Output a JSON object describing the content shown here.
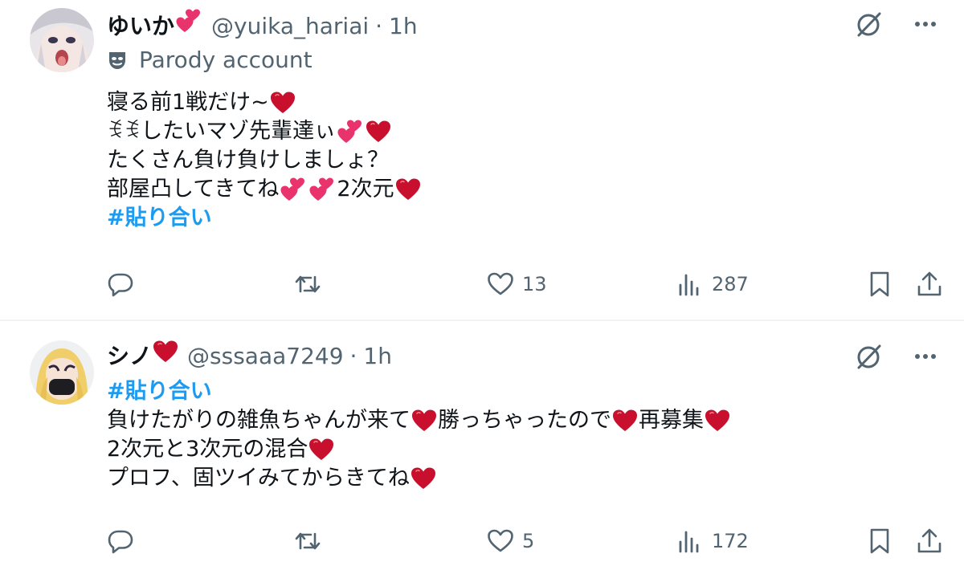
{
  "tweets": [
    {
      "display_name": "ゆいか",
      "handle": "@yuika_hariai",
      "separator": "·",
      "time": "1h",
      "parody_label": "Parody account",
      "lines": [
        "寝る前1戦だけ~",
        "ꉂꉂしたいマゾ先輩達ぃ",
        "たくさん負け負けしましょ？",
        "部屋凸してきてね",
        "2次元"
      ],
      "hashtag": "#貼り合い",
      "likes": "13",
      "views": "287"
    },
    {
      "display_name": "シノ",
      "handle": "@sssaaa7249",
      "separator": "·",
      "time": "1h",
      "hashtag": "#貼り合い",
      "lines": [
        "負けたがりの雑魚ちゃんが来て",
        "勝っちゃったので",
        "再募集",
        "2次元と3次元の混合",
        "プロフ、固ツイみてからきてね"
      ],
      "likes": "5",
      "views": "172"
    }
  ],
  "icons": {
    "verified_like": "parody-mask-icon",
    "grok": "grok-icon",
    "more": "more-icon",
    "reply": "reply-icon",
    "repost": "repost-icon",
    "like": "like-icon",
    "views": "views-icon",
    "bookmark": "bookmark-icon",
    "share": "share-icon"
  },
  "colors": {
    "text": "#0f1419",
    "secondary": "#536471",
    "link": "#1d9bf0",
    "heart": "#c8102e",
    "pink_heart": "#e8336d"
  }
}
